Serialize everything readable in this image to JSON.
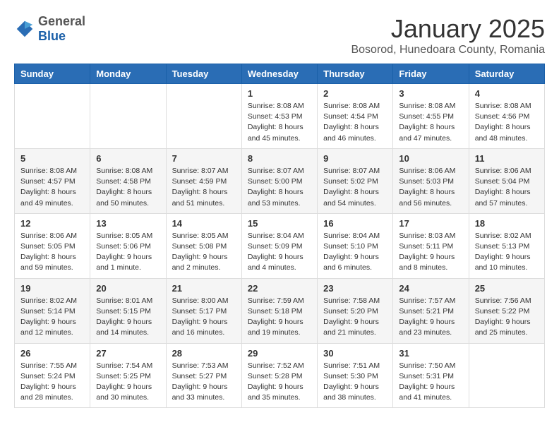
{
  "header": {
    "logo_general": "General",
    "logo_blue": "Blue",
    "month_title": "January 2025",
    "subtitle": "Bosorod, Hunedoara County, Romania"
  },
  "weekdays": [
    "Sunday",
    "Monday",
    "Tuesday",
    "Wednesday",
    "Thursday",
    "Friday",
    "Saturday"
  ],
  "weeks": [
    [
      {
        "day": "",
        "sunrise": "",
        "sunset": "",
        "daylight": ""
      },
      {
        "day": "",
        "sunrise": "",
        "sunset": "",
        "daylight": ""
      },
      {
        "day": "",
        "sunrise": "",
        "sunset": "",
        "daylight": ""
      },
      {
        "day": "1",
        "sunrise": "Sunrise: 8:08 AM",
        "sunset": "Sunset: 4:53 PM",
        "daylight": "Daylight: 8 hours and 45 minutes."
      },
      {
        "day": "2",
        "sunrise": "Sunrise: 8:08 AM",
        "sunset": "Sunset: 4:54 PM",
        "daylight": "Daylight: 8 hours and 46 minutes."
      },
      {
        "day": "3",
        "sunrise": "Sunrise: 8:08 AM",
        "sunset": "Sunset: 4:55 PM",
        "daylight": "Daylight: 8 hours and 47 minutes."
      },
      {
        "day": "4",
        "sunrise": "Sunrise: 8:08 AM",
        "sunset": "Sunset: 4:56 PM",
        "daylight": "Daylight: 8 hours and 48 minutes."
      }
    ],
    [
      {
        "day": "5",
        "sunrise": "Sunrise: 8:08 AM",
        "sunset": "Sunset: 4:57 PM",
        "daylight": "Daylight: 8 hours and 49 minutes."
      },
      {
        "day": "6",
        "sunrise": "Sunrise: 8:08 AM",
        "sunset": "Sunset: 4:58 PM",
        "daylight": "Daylight: 8 hours and 50 minutes."
      },
      {
        "day": "7",
        "sunrise": "Sunrise: 8:07 AM",
        "sunset": "Sunset: 4:59 PM",
        "daylight": "Daylight: 8 hours and 51 minutes."
      },
      {
        "day": "8",
        "sunrise": "Sunrise: 8:07 AM",
        "sunset": "Sunset: 5:00 PM",
        "daylight": "Daylight: 8 hours and 53 minutes."
      },
      {
        "day": "9",
        "sunrise": "Sunrise: 8:07 AM",
        "sunset": "Sunset: 5:02 PM",
        "daylight": "Daylight: 8 hours and 54 minutes."
      },
      {
        "day": "10",
        "sunrise": "Sunrise: 8:06 AM",
        "sunset": "Sunset: 5:03 PM",
        "daylight": "Daylight: 8 hours and 56 minutes."
      },
      {
        "day": "11",
        "sunrise": "Sunrise: 8:06 AM",
        "sunset": "Sunset: 5:04 PM",
        "daylight": "Daylight: 8 hours and 57 minutes."
      }
    ],
    [
      {
        "day": "12",
        "sunrise": "Sunrise: 8:06 AM",
        "sunset": "Sunset: 5:05 PM",
        "daylight": "Daylight: 8 hours and 59 minutes."
      },
      {
        "day": "13",
        "sunrise": "Sunrise: 8:05 AM",
        "sunset": "Sunset: 5:06 PM",
        "daylight": "Daylight: 9 hours and 1 minute."
      },
      {
        "day": "14",
        "sunrise": "Sunrise: 8:05 AM",
        "sunset": "Sunset: 5:08 PM",
        "daylight": "Daylight: 9 hours and 2 minutes."
      },
      {
        "day": "15",
        "sunrise": "Sunrise: 8:04 AM",
        "sunset": "Sunset: 5:09 PM",
        "daylight": "Daylight: 9 hours and 4 minutes."
      },
      {
        "day": "16",
        "sunrise": "Sunrise: 8:04 AM",
        "sunset": "Sunset: 5:10 PM",
        "daylight": "Daylight: 9 hours and 6 minutes."
      },
      {
        "day": "17",
        "sunrise": "Sunrise: 8:03 AM",
        "sunset": "Sunset: 5:11 PM",
        "daylight": "Daylight: 9 hours and 8 minutes."
      },
      {
        "day": "18",
        "sunrise": "Sunrise: 8:02 AM",
        "sunset": "Sunset: 5:13 PM",
        "daylight": "Daylight: 9 hours and 10 minutes."
      }
    ],
    [
      {
        "day": "19",
        "sunrise": "Sunrise: 8:02 AM",
        "sunset": "Sunset: 5:14 PM",
        "daylight": "Daylight: 9 hours and 12 minutes."
      },
      {
        "day": "20",
        "sunrise": "Sunrise: 8:01 AM",
        "sunset": "Sunset: 5:15 PM",
        "daylight": "Daylight: 9 hours and 14 minutes."
      },
      {
        "day": "21",
        "sunrise": "Sunrise: 8:00 AM",
        "sunset": "Sunset: 5:17 PM",
        "daylight": "Daylight: 9 hours and 16 minutes."
      },
      {
        "day": "22",
        "sunrise": "Sunrise: 7:59 AM",
        "sunset": "Sunset: 5:18 PM",
        "daylight": "Daylight: 9 hours and 19 minutes."
      },
      {
        "day": "23",
        "sunrise": "Sunrise: 7:58 AM",
        "sunset": "Sunset: 5:20 PM",
        "daylight": "Daylight: 9 hours and 21 minutes."
      },
      {
        "day": "24",
        "sunrise": "Sunrise: 7:57 AM",
        "sunset": "Sunset: 5:21 PM",
        "daylight": "Daylight: 9 hours and 23 minutes."
      },
      {
        "day": "25",
        "sunrise": "Sunrise: 7:56 AM",
        "sunset": "Sunset: 5:22 PM",
        "daylight": "Daylight: 9 hours and 25 minutes."
      }
    ],
    [
      {
        "day": "26",
        "sunrise": "Sunrise: 7:55 AM",
        "sunset": "Sunset: 5:24 PM",
        "daylight": "Daylight: 9 hours and 28 minutes."
      },
      {
        "day": "27",
        "sunrise": "Sunrise: 7:54 AM",
        "sunset": "Sunset: 5:25 PM",
        "daylight": "Daylight: 9 hours and 30 minutes."
      },
      {
        "day": "28",
        "sunrise": "Sunrise: 7:53 AM",
        "sunset": "Sunset: 5:27 PM",
        "daylight": "Daylight: 9 hours and 33 minutes."
      },
      {
        "day": "29",
        "sunrise": "Sunrise: 7:52 AM",
        "sunset": "Sunset: 5:28 PM",
        "daylight": "Daylight: 9 hours and 35 minutes."
      },
      {
        "day": "30",
        "sunrise": "Sunrise: 7:51 AM",
        "sunset": "Sunset: 5:30 PM",
        "daylight": "Daylight: 9 hours and 38 minutes."
      },
      {
        "day": "31",
        "sunrise": "Sunrise: 7:50 AM",
        "sunset": "Sunset: 5:31 PM",
        "daylight": "Daylight: 9 hours and 41 minutes."
      },
      {
        "day": "",
        "sunrise": "",
        "sunset": "",
        "daylight": ""
      }
    ]
  ]
}
